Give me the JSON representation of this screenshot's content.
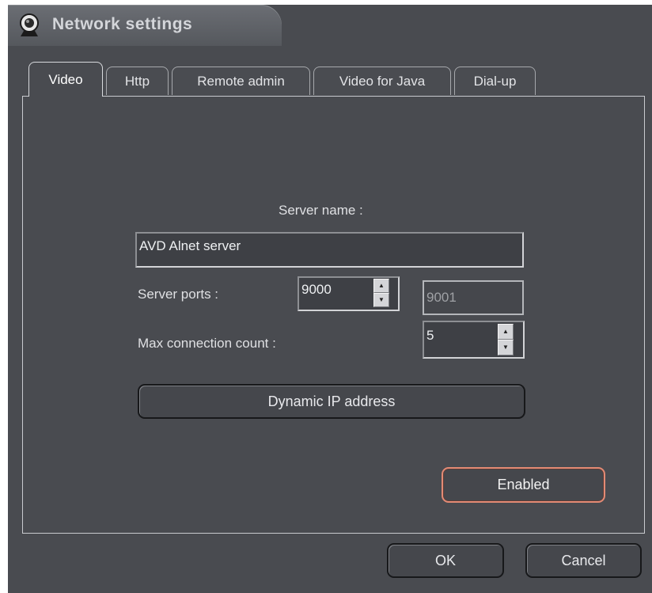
{
  "window": {
    "title": "Network settings",
    "title_icon": "webcam-icon"
  },
  "tabs": [
    {
      "label": "Video",
      "active": true
    },
    {
      "label": "Http",
      "active": false
    },
    {
      "label": "Remote admin",
      "active": false
    },
    {
      "label": "Video for Java",
      "active": false
    },
    {
      "label": "Dial-up",
      "active": false
    }
  ],
  "video": {
    "server_name_label": "Server name :",
    "server_name_value": "AVD  Alnet server",
    "server_ports_label": "Server ports :",
    "server_port_value": "9000",
    "server_port_secondary_value": "9001",
    "max_connection_label": "Max connection count :",
    "max_connection_value": "5",
    "dynamic_ip_button": "Dynamic IP address",
    "enabled_button": "Enabled"
  },
  "footer": {
    "ok_label": "OK",
    "cancel_label": "Cancel"
  },
  "colors": {
    "background": "#494b50",
    "title_bar": "#5f6267",
    "accent_border": "#e38a74"
  }
}
